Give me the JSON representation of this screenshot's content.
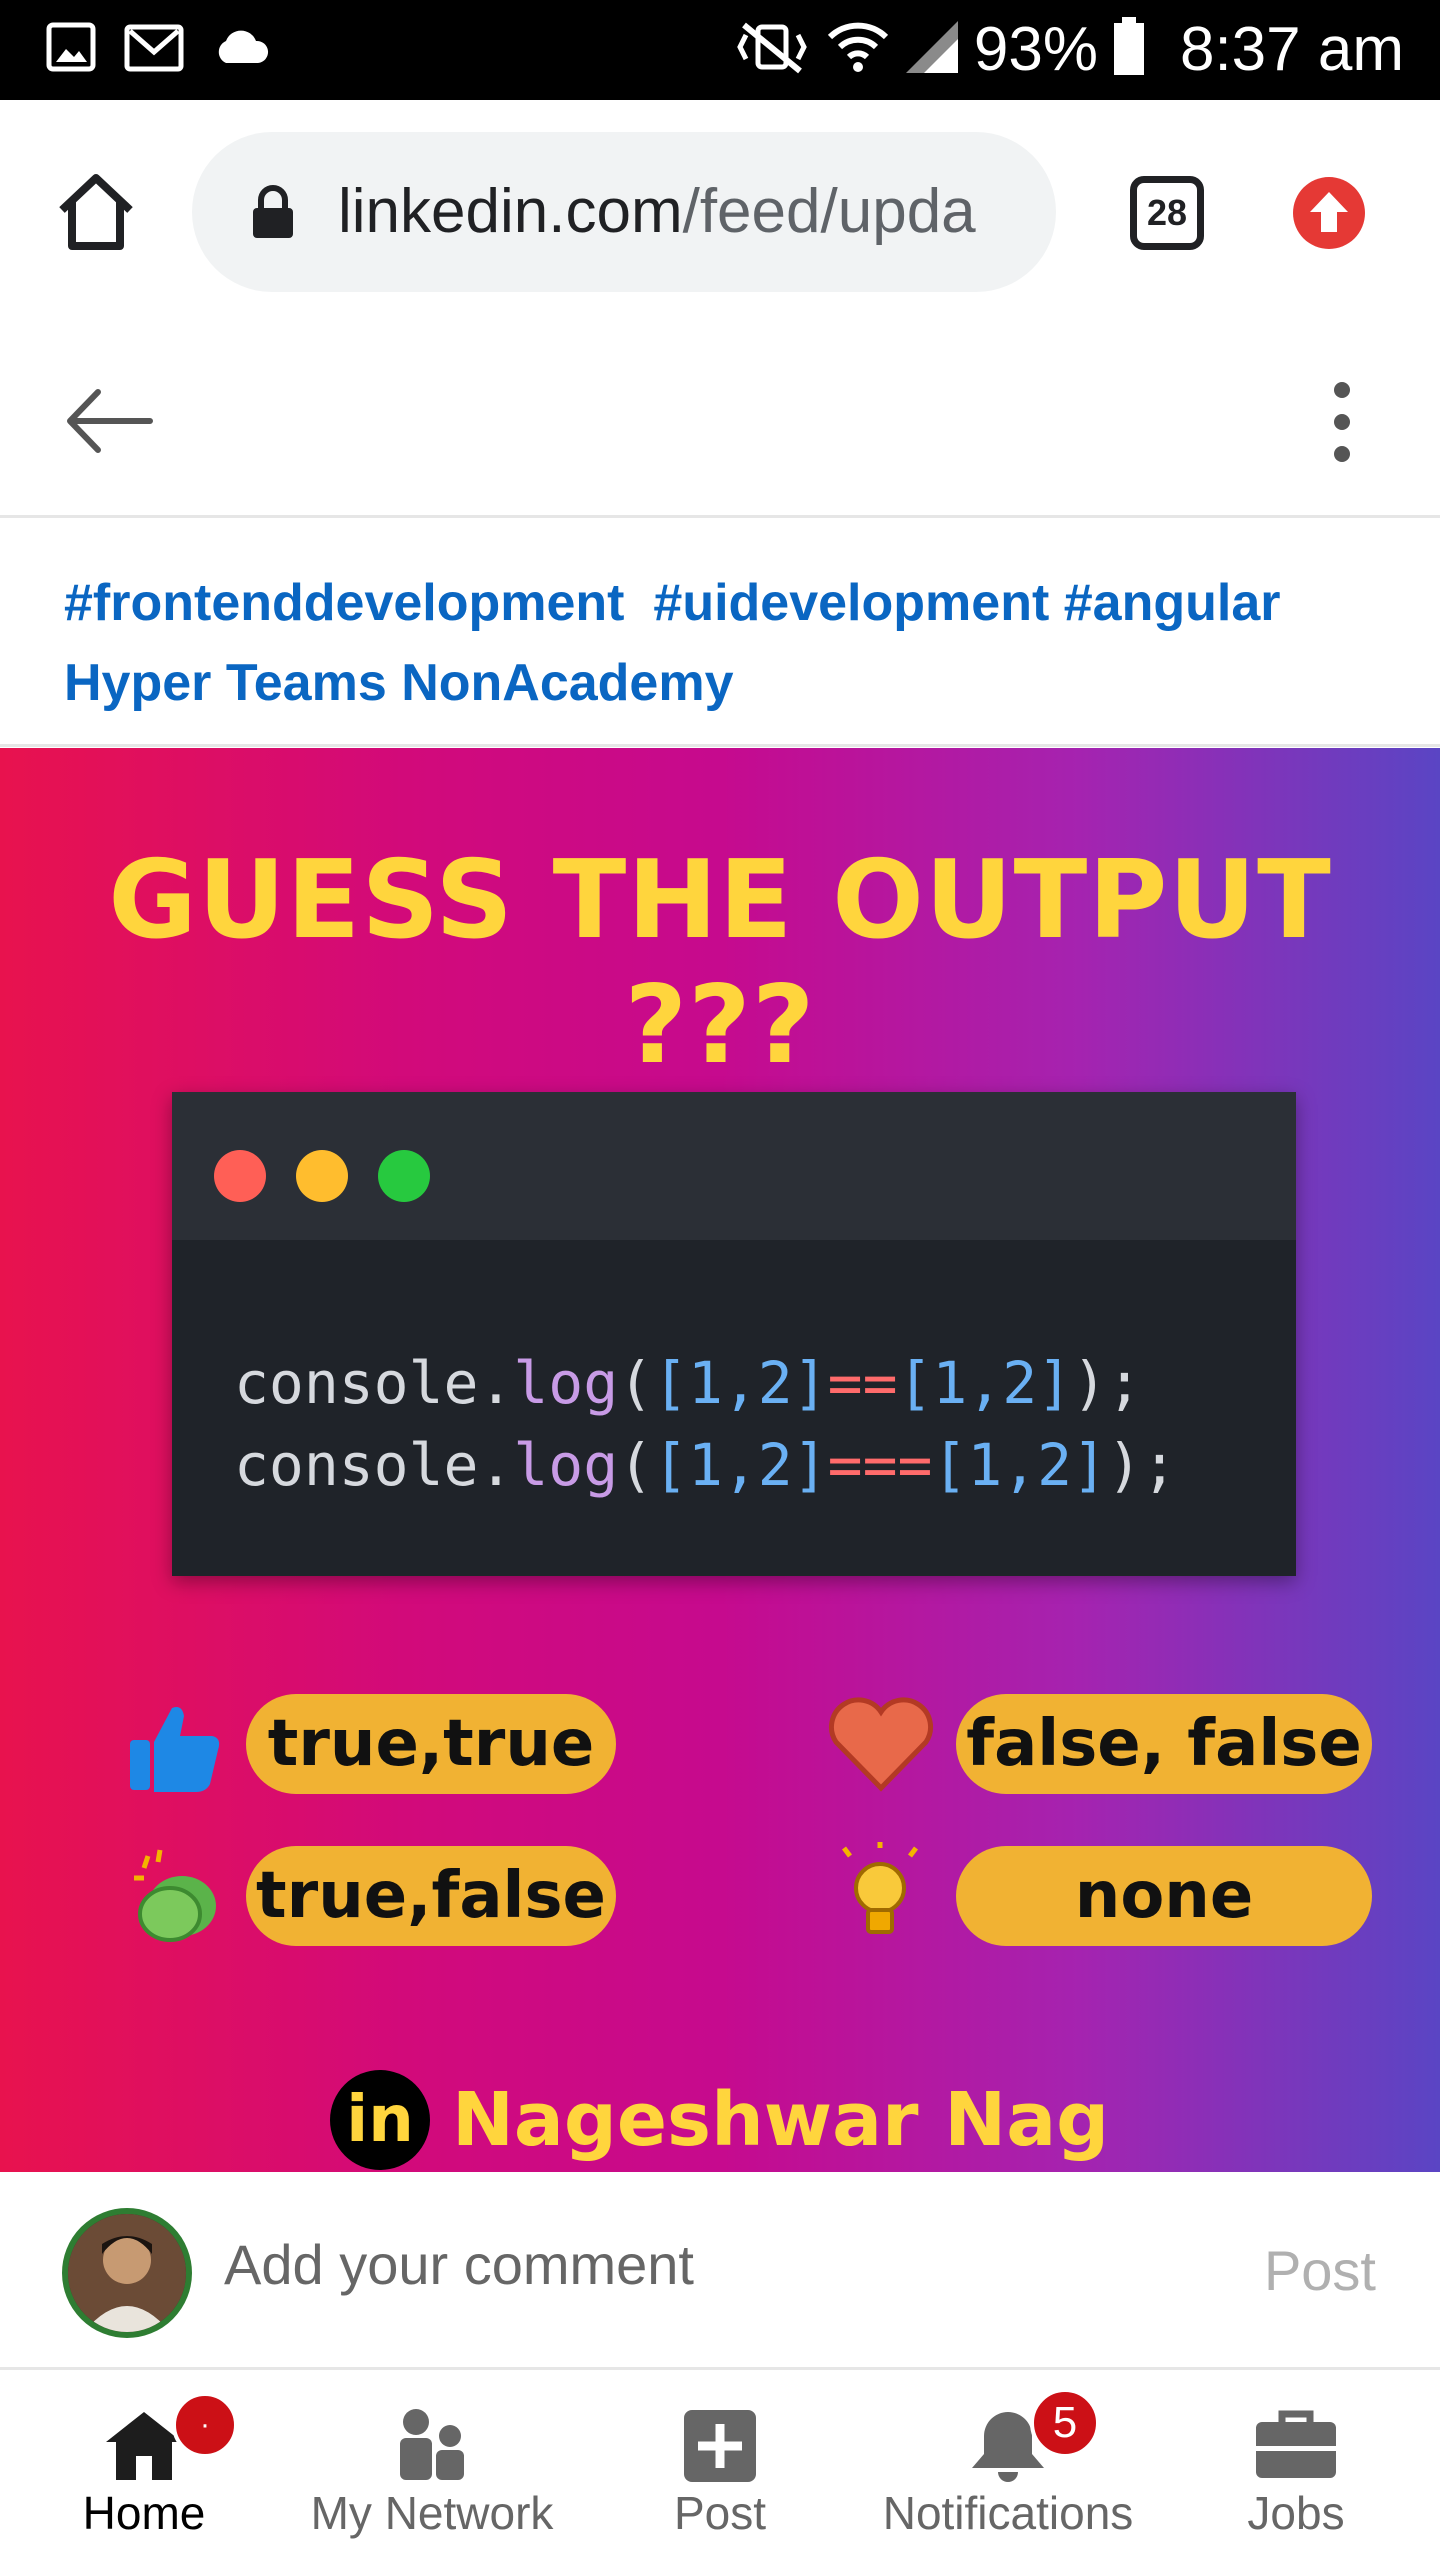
{
  "status_bar": {
    "battery": "93%",
    "time": "8:37 am",
    "icons": [
      "image-icon",
      "gmail-icon",
      "cloud-icon",
      "mute-vibrate-icon",
      "wifi-icon",
      "signal-icon",
      "battery-icon"
    ]
  },
  "browser": {
    "url_domain": "linkedin.com",
    "url_path": "/feed/upda",
    "tab_count": "28",
    "accent": "#e53935"
  },
  "post": {
    "hashtags_line1": [
      "#frontenddevelopment",
      "#uidevelopment",
      "#angular"
    ],
    "hashtags_line2": "Hyper Teams NonAcademy",
    "image": {
      "headline": "GUESS THE OUTPUT ???",
      "code_line1": {
        "obj": "console",
        "dot": ".",
        "fn": "log",
        "open": "(",
        "a": "[1,2]",
        "op": "==",
        "b": "[1,2]",
        "close": ");"
      },
      "code_line2": {
        "obj": "console",
        "dot": ".",
        "fn": "log",
        "open": "(",
        "a": "[1,2]",
        "op": "===",
        "b": "[1,2]",
        "close": ");"
      },
      "options": [
        {
          "icon": "thumbs-up-icon",
          "label": "true,true"
        },
        {
          "icon": "heart-icon",
          "label": "false, false"
        },
        {
          "icon": "clapping-hands-icon",
          "label": "true,false"
        },
        {
          "icon": "lightbulb-icon",
          "label": "none"
        }
      ],
      "author_badge": "in",
      "author_name": "Nageshwar Nag"
    }
  },
  "comment": {
    "placeholder": "Add your comment",
    "post_label": "Post"
  },
  "bottom_nav": {
    "items": [
      {
        "label": "Home",
        "active": true,
        "badge": "·"
      },
      {
        "label": "My Network"
      },
      {
        "label": "Post"
      },
      {
        "label": "Notifications",
        "badge": "5"
      },
      {
        "label": "Jobs"
      }
    ]
  }
}
